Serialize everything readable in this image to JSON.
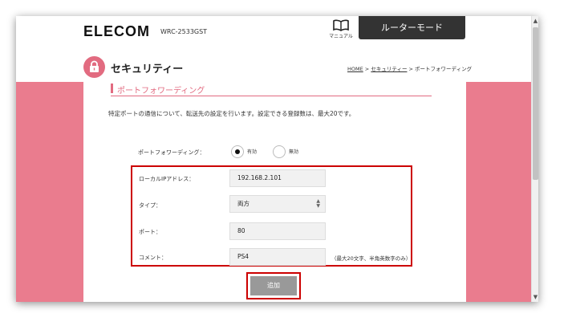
{
  "header": {
    "logo": "ELECOM",
    "model": "WRC-2533GST",
    "manual_label": "マニュアル",
    "mode_button": "ルーターモード"
  },
  "page": {
    "title": "セキュリティー",
    "breadcrumb": {
      "home": "HOME",
      "sep1": " > ",
      "security": "セキュリティー",
      "sep2": " > ",
      "current": "ポートフォワーディング"
    }
  },
  "section": {
    "heading": "ポートフォワーディング",
    "description": "特定ポートの通信について、転送先の設定を行います。設定できる登録数は、最大20です。"
  },
  "form": {
    "pf_label": "ポートフォワーディング：",
    "pf_options": [
      {
        "label": "有効",
        "selected": true
      },
      {
        "label": "無効",
        "selected": false
      }
    ],
    "local_ip_label": "ローカルIPアドレス：",
    "local_ip_value": "192.168.2.101",
    "type_label": "タイプ：",
    "type_value": "両方",
    "port_label": "ポート：",
    "port_value": "80",
    "comment_label": "コメント：",
    "comment_value": "PS4",
    "comment_hint": "（最大20文字、半角英数字のみ）",
    "add_button": "追加"
  },
  "colors": {
    "accent": "#e26b80",
    "side_panel": "#ea7c8e",
    "highlight_box": "#cc0000",
    "mode_button_bg": "#333333",
    "add_button_bg": "#999999"
  },
  "icons": {
    "manual": "book-icon",
    "security": "lock-icon",
    "scroll_up": "chevron-up-icon",
    "scroll_down": "chevron-down-icon",
    "select": "updown-arrows-icon"
  }
}
